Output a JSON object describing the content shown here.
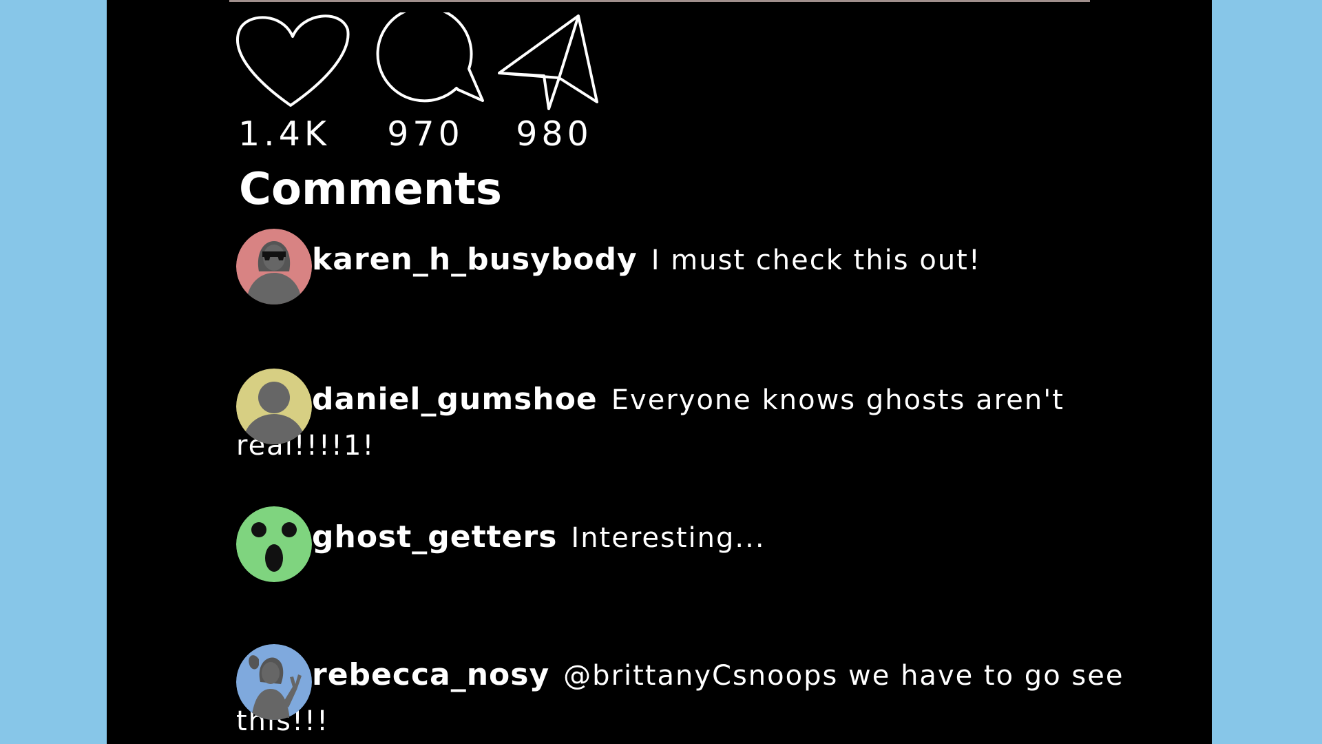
{
  "actions": {
    "likes": "1.4K",
    "comments_count": "970",
    "shares": "980"
  },
  "comments_title": "Comments",
  "comments": [
    {
      "username": "karen_h_busybody",
      "text": "I must check this out!",
      "avatar_color": "#d88383"
    },
    {
      "username": "daniel_gumshoe",
      "text": "Everyone knows ghosts aren't real!!!!1!",
      "avatar_color": "#d7cf83"
    },
    {
      "username": "ghost_getters",
      "text": "Interesting...",
      "avatar_color": "#7fd47f"
    },
    {
      "username": "rebecca_nosy",
      "text": "@brittanyCsnoops we have to go see this!!!",
      "avatar_color": "#7fa9dd"
    }
  ],
  "icons": [
    "heart-icon",
    "speech-bubble-icon",
    "paper-plane-icon"
  ],
  "colors": {
    "background": "#87c6e8",
    "panel": "#000000",
    "text": "#ffffff"
  }
}
